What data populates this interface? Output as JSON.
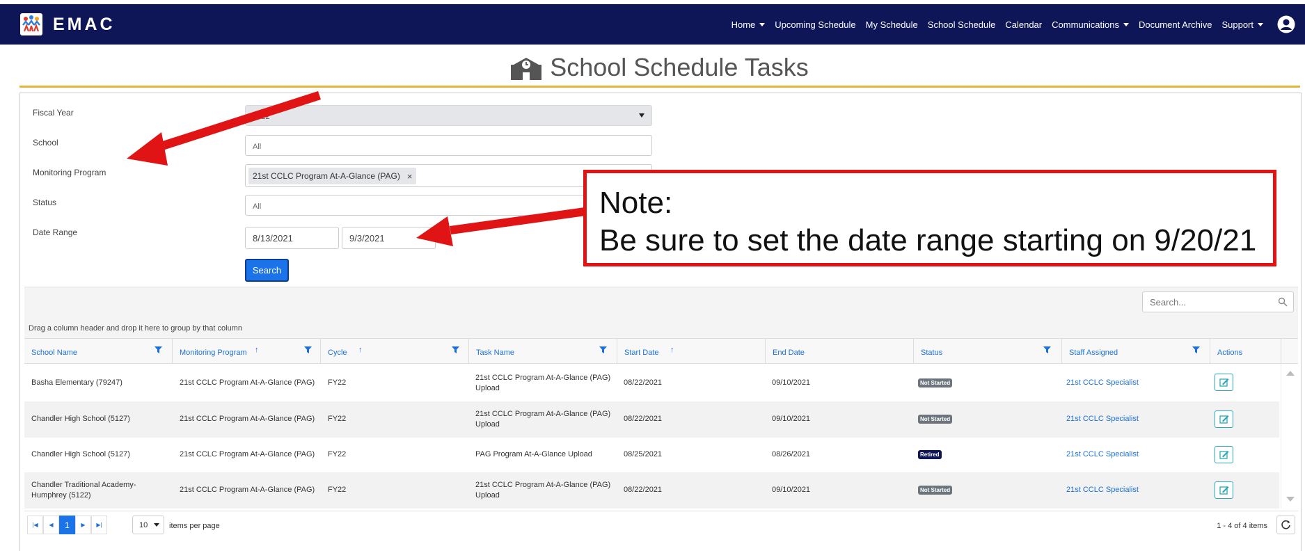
{
  "app": {
    "name": "EMAC"
  },
  "nav": {
    "items": [
      {
        "label": "Home",
        "dropdown": true
      },
      {
        "label": "Upcoming Schedule",
        "dropdown": false
      },
      {
        "label": "My Schedule",
        "dropdown": false
      },
      {
        "label": "School Schedule",
        "dropdown": false
      },
      {
        "label": "Calendar",
        "dropdown": false
      },
      {
        "label": "Communications",
        "dropdown": true
      },
      {
        "label": "Document Archive",
        "dropdown": false
      },
      {
        "label": "Support",
        "dropdown": true
      }
    ]
  },
  "page": {
    "title": "School Schedule Tasks"
  },
  "filters": {
    "fiscal_year": {
      "label": "Fiscal Year",
      "value": "2022"
    },
    "school": {
      "label": "School",
      "placeholder": "All"
    },
    "monitoring_program": {
      "label": "Monitoring Program",
      "chip": "21st CCLC Program At-A-Glance (PAG)",
      "chip_remove": "×"
    },
    "status": {
      "label": "Status",
      "placeholder": "All"
    },
    "date_range": {
      "label": "Date Range",
      "start": "8/13/2021",
      "end": "9/3/2021"
    },
    "search_label": "Search"
  },
  "grid": {
    "search_placeholder": "Search...",
    "group_hint": "Drag a column header and drop it here to group by that column",
    "columns": [
      "School Name",
      "Monitoring Program",
      "Cycle",
      "Task Name",
      "Start Date",
      "End Date",
      "Status",
      "Staff Assigned",
      "Actions"
    ],
    "rows": [
      {
        "school": "Basha Elementary (79247)",
        "program": "21st CCLC Program At-A-Glance (PAG)",
        "cycle": "FY22",
        "task": "21st CCLC Program At-A-Glance (PAG) Upload",
        "start": "08/22/2021",
        "end": "09/10/2021",
        "status": "Not Started",
        "staff": "21st CCLC Specialist"
      },
      {
        "school": "Chandler High School (5127)",
        "program": "21st CCLC Program At-A-Glance (PAG)",
        "cycle": "FY22",
        "task": "21st CCLC Program At-A-Glance (PAG) Upload",
        "start": "08/22/2021",
        "end": "09/10/2021",
        "status": "Not Started",
        "staff": "21st CCLC Specialist"
      },
      {
        "school": "Chandler High School (5127)",
        "program": "21st CCLC Program At-A-Glance (PAG)",
        "cycle": "FY22",
        "task": "PAG Program At-A-Glance Upload",
        "start": "08/25/2021",
        "end": "08/26/2021",
        "status": "Retired",
        "staff": "21st CCLC Specialist"
      },
      {
        "school": "Chandler Traditional Academy-Humphrey (5122)",
        "program": "21st CCLC Program At-A-Glance (PAG)",
        "cycle": "FY22",
        "task": "21st CCLC Program At-A-Glance (PAG) Upload",
        "start": "08/22/2021",
        "end": "09/10/2021",
        "status": "Not Started",
        "staff": "21st CCLC Specialist"
      }
    ]
  },
  "pager": {
    "current_page": "1",
    "page_size": "10",
    "page_size_label": "items per page",
    "summary": "1 - 4 of 4 items"
  },
  "note": {
    "line1": "Note:",
    "line2": "Be sure to set the date range starting on 9/20/21"
  },
  "colors": {
    "navbar": "#0f1657",
    "accent_rule": "#e3b53b",
    "link": "#1a6fd8",
    "annotation": "#e01414"
  }
}
